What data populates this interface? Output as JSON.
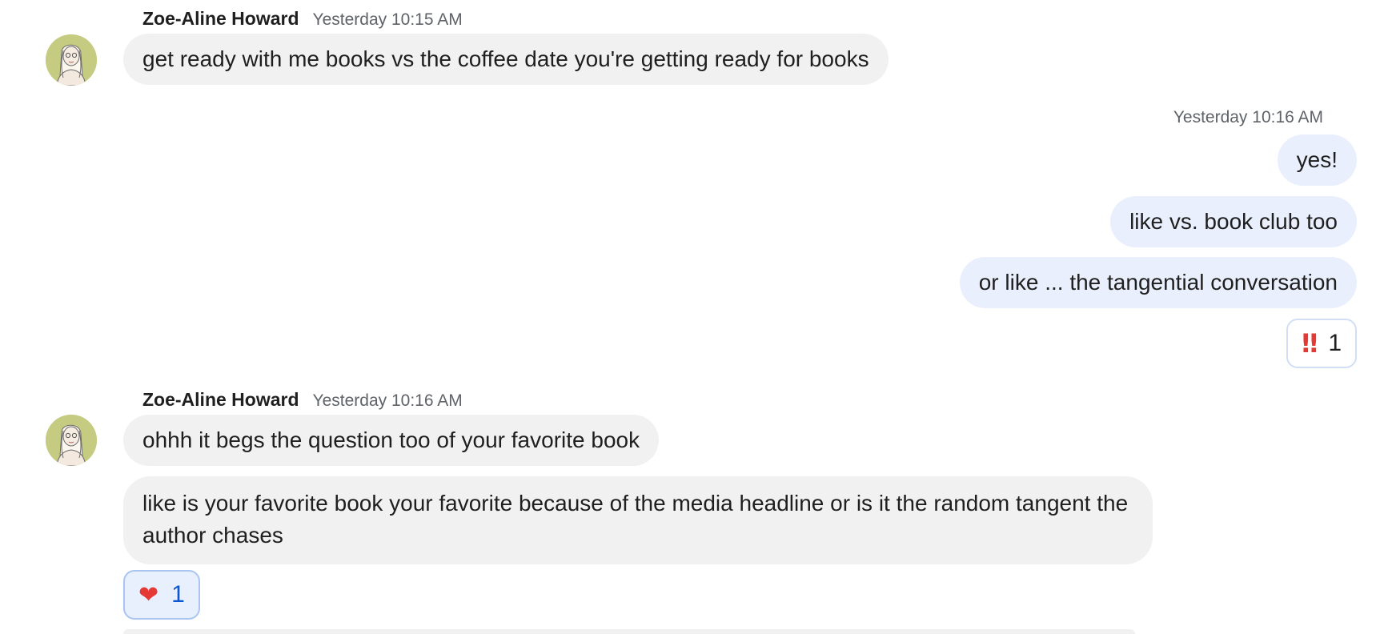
{
  "messages": {
    "group1": {
      "sender": "Zoe-Aline Howard",
      "time": "Yesterday 10:15 AM",
      "bubbles": [
        "get ready with me books vs the coffee date you're getting ready for books"
      ]
    },
    "outgoing": {
      "time": "Yesterday 10:16 AM",
      "bubbles": [
        "yes!",
        "like vs. book club too",
        "or like ... the tangential conversation"
      ],
      "reaction": {
        "emoji": "‼",
        "icon": "double-exclamation-icon",
        "count": "1"
      }
    },
    "group2": {
      "sender": "Zoe-Aline Howard",
      "time": "Yesterday 10:16 AM",
      "bubbles": [
        "ohhh it begs the question too of your favorite book",
        "like is your favorite book your favorite because of the media headline or is it the random tangent the author chases"
      ],
      "reaction": {
        "emoji": "❤",
        "icon": "red-heart-icon",
        "count": "1"
      }
    }
  },
  "colors": {
    "incoming_bubble": "#f1f1f1",
    "outgoing_bubble": "#e9effc",
    "avatar_bg": "#c6cb82",
    "self_reaction_accent": "#0b57d0"
  }
}
